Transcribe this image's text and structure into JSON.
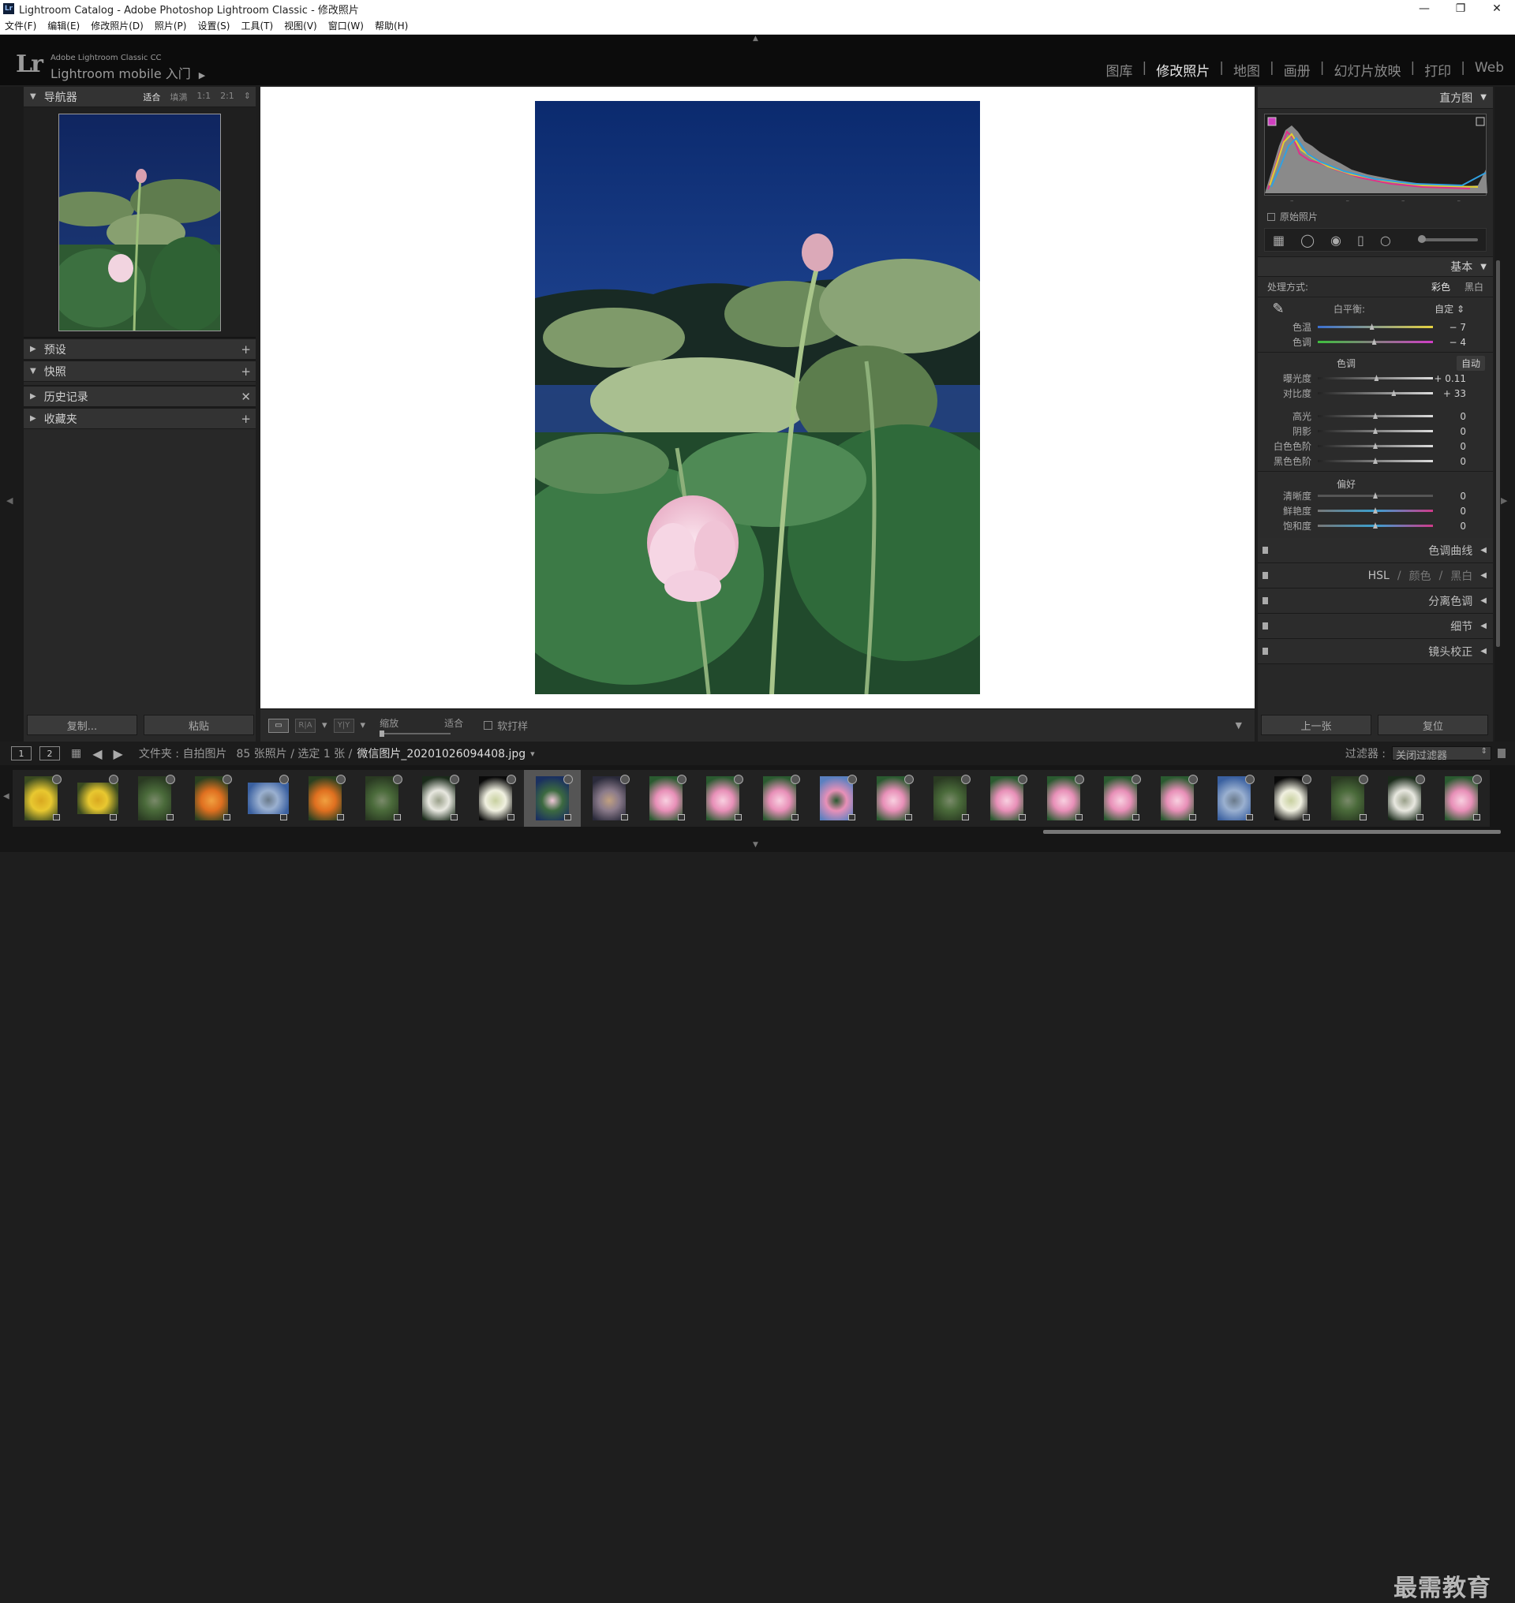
{
  "window": {
    "title": "Lightroom Catalog - Adobe Photoshop Lightroom Classic - 修改照片",
    "app_icon": "Lr",
    "controls": [
      "—",
      "❐",
      "✕"
    ]
  },
  "menu": [
    "文件(F)",
    "编辑(E)",
    "修改照片(D)",
    "照片(P)",
    "设置(S)",
    "工具(T)",
    "视图(V)",
    "窗口(W)",
    "帮助(H)"
  ],
  "brand": {
    "logo": "Lr",
    "product": "Adobe Lightroom Classic CC",
    "mobile": "Lightroom mobile 入门",
    "arrow": "▶"
  },
  "modules": [
    {
      "label": "图库",
      "active": false
    },
    {
      "label": "修改照片",
      "active": true
    },
    {
      "label": "地图",
      "active": false
    },
    {
      "label": "画册",
      "active": false
    },
    {
      "label": "幻灯片放映",
      "active": false
    },
    {
      "label": "打印",
      "active": false
    },
    {
      "label": "Web",
      "active": false
    }
  ],
  "module_sep": "|",
  "left": {
    "navigator": {
      "title": "导航器",
      "opts": [
        "适合",
        "填满",
        "1:1",
        "2:1"
      ],
      "selected": "适合",
      "opts_caret": "⇕"
    },
    "panels": [
      {
        "title": "预设",
        "action": "+",
        "open": false
      },
      {
        "title": "快照",
        "action": "+",
        "open": true
      },
      {
        "title": "历史记录",
        "action": "✕",
        "open": false
      },
      {
        "title": "收藏夹",
        "action": "+",
        "open": false
      }
    ],
    "copy": "复制...",
    "paste": "粘贴"
  },
  "toolbar": {
    "view_single": "▭",
    "view_ra": "R|A",
    "view_yy": "Y|Y",
    "caret": "▾",
    "zoom_label": "缩放",
    "zoom_value": "适合",
    "softproof": "软打样",
    "more": "▼"
  },
  "right": {
    "histogram_title": "直方图",
    "original_photo": "原始照片",
    "tools": [
      "▦",
      "◯",
      "◉",
      "▯",
      "○"
    ],
    "basic": {
      "title": "基本",
      "treatment_label": "处理方式:",
      "treatment_opts": [
        "彩色",
        "黑白"
      ],
      "treatment_sel": "彩色",
      "wb_label": "白平衡:",
      "wb_value": "自定 ⇕",
      "dropper_icon": "✎",
      "wb_sliders": [
        {
          "label": "色温",
          "value": "− 7",
          "pos": 0.47,
          "grad": "linear-gradient(90deg,#3a6fd0,#e6d240)"
        },
        {
          "label": "色调",
          "value": "− 4",
          "pos": 0.49,
          "grad": "linear-gradient(90deg,#3dbf3d,#d13dc7)"
        }
      ],
      "tone_title": "色调",
      "auto": "自动",
      "tone_sliders": [
        {
          "label": "曝光度",
          "value": "+ 0.11",
          "pos": 0.51
        },
        {
          "label": "对比度",
          "value": "+ 33",
          "pos": 0.66
        }
      ],
      "region_sliders": [
        {
          "label": "高光",
          "value": "0",
          "pos": 0.5
        },
        {
          "label": "阴影",
          "value": "0",
          "pos": 0.5
        },
        {
          "label": "白色色阶",
          "value": "0",
          "pos": 0.5
        },
        {
          "label": "黑色色阶",
          "value": "0",
          "pos": 0.5
        }
      ],
      "presence_title": "偏好",
      "presence_sliders": [
        {
          "label": "清晰度",
          "value": "0",
          "pos": 0.5
        },
        {
          "label": "鲜艳度",
          "value": "0",
          "pos": 0.5
        },
        {
          "label": "饱和度",
          "value": "0",
          "pos": 0.5
        }
      ]
    },
    "collapsed": [
      {
        "title": "色调曲线"
      },
      {
        "title": "HSL",
        "extra": [
          "颜色",
          "黑白"
        ],
        "sep": "/"
      },
      {
        "title": "分离色调"
      },
      {
        "title": "细节"
      },
      {
        "title": "镜头校正"
      }
    ],
    "prev": "上一张",
    "reset": "复位"
  },
  "filmbar": {
    "screen1": "1",
    "screen2": "2",
    "grid_icon": "▦",
    "back_icon": "◀",
    "fwd_icon": "▶",
    "path_prefix": "文件夹 : 自拍图片",
    "count": "85 张照片 / 选定 1 张 /",
    "filename": "微信图片_20201026094408.jpg",
    "filename_caret": "▾",
    "filter_label": "过滤器 :",
    "filter_value": "关闭过滤器",
    "filter_caret": "⇕"
  },
  "filmstrip": {
    "thumbs": [
      {
        "kind": "yellow",
        "selected": false
      },
      {
        "kind": "yellow",
        "selected": false,
        "wide": true
      },
      {
        "kind": "tree",
        "selected": false
      },
      {
        "kind": "orange",
        "selected": false
      },
      {
        "kind": "sky",
        "selected": false,
        "wide": true
      },
      {
        "kind": "orange",
        "selected": false
      },
      {
        "kind": "tree",
        "selected": false
      },
      {
        "kind": "white",
        "selected": false
      },
      {
        "kind": "whitebw",
        "selected": false
      },
      {
        "kind": "lotusnight",
        "selected": true
      },
      {
        "kind": "dusk",
        "selected": false
      },
      {
        "kind": "pink",
        "selected": false
      },
      {
        "kind": "pink",
        "selected": false
      },
      {
        "kind": "pink",
        "selected": false
      },
      {
        "kind": "pinksky",
        "selected": false
      },
      {
        "kind": "pink",
        "selected": false
      },
      {
        "kind": "tree",
        "selected": false
      },
      {
        "kind": "pink",
        "selected": false
      },
      {
        "kind": "pink",
        "selected": false
      },
      {
        "kind": "pink",
        "selected": false
      },
      {
        "kind": "pink",
        "selected": false
      },
      {
        "kind": "sky",
        "selected": false
      },
      {
        "kind": "whitebw",
        "selected": false
      },
      {
        "kind": "tree",
        "selected": false
      },
      {
        "kind": "white",
        "selected": false
      },
      {
        "kind": "pink",
        "selected": false
      }
    ]
  },
  "watermark": "最需教育"
}
